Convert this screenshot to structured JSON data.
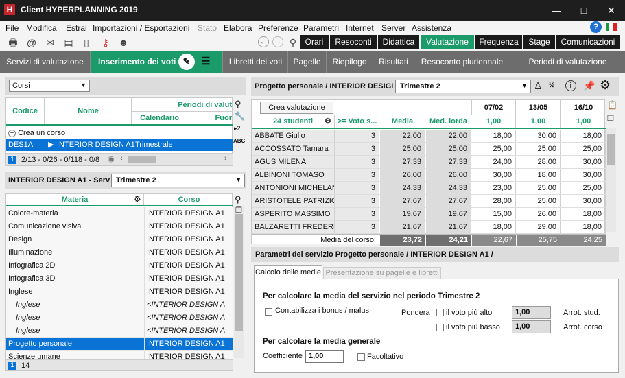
{
  "window": {
    "title": "Client HYPERPLANNING 2019",
    "logo": "H",
    "min": "—",
    "max": "□",
    "close": "✕"
  },
  "menu": [
    "File",
    "Modifica",
    "Estrai",
    "Importazioni / Esportazioni",
    "Stato",
    "Elabora",
    "Preferenze",
    "Parametri",
    "Internet",
    "Server",
    "Assistenza"
  ],
  "help": "?",
  "navtabs": [
    "Orari",
    "Resoconti",
    "Didattica",
    "Valutazione",
    "Frequenza",
    "Stage",
    "Comunicazioni"
  ],
  "subtabs": [
    "Servizi di valutazione",
    "Inserimento dei voti",
    "Libretti dei voti",
    "Pagelle",
    "Riepilogo",
    "Risultati",
    "Resoconto pluriennale",
    "Periodi di valutazione"
  ],
  "left_top": {
    "select": "Corsi",
    "col_code": "Codice",
    "col_name": "Nome",
    "col_periods": "Periodi di valut",
    "col_cal": "Calendario",
    "col_fuori": "Fuor",
    "create": "Crea un corso",
    "row": {
      "code": "DES1A",
      "name": "INTERIOR DESIGN A1",
      "cal": "Trimestrale"
    },
    "page": "1",
    "status": "2/13 - 0/26 - 0/118 - 0/8"
  },
  "left_bottom": {
    "label": "INTERIOR DESIGN A1 - Serv",
    "period": "Trimestre 2",
    "col_subject": "Materia",
    "col_course": "Corso",
    "rows": [
      {
        "s": "Colore-materia",
        "c": "INTERIOR DESIGN A1",
        "i": false
      },
      {
        "s": "Comunicazione visiva",
        "c": "INTERIOR DESIGN A1",
        "i": false
      },
      {
        "s": "Design",
        "c": "INTERIOR DESIGN A1",
        "i": false
      },
      {
        "s": "Illuminazione",
        "c": "INTERIOR DESIGN A1",
        "i": false
      },
      {
        "s": "Infografica 2D",
        "c": "INTERIOR DESIGN A1",
        "i": false
      },
      {
        "s": "Infografica 3D",
        "c": "INTERIOR DESIGN A1",
        "i": false
      },
      {
        "s": "Inglese",
        "c": "INTERIOR DESIGN A1",
        "i": false
      },
      {
        "s": "Inglese",
        "c": "<INTERIOR DESIGN A",
        "i": true
      },
      {
        "s": "Inglese",
        "c": "<INTERIOR DESIGN A",
        "i": true
      },
      {
        "s": "Inglese",
        "c": "<INTERIOR DESIGN A",
        "i": true
      },
      {
        "s": "Progetto personale",
        "c": "INTERIOR DESIGN A1",
        "i": false
      },
      {
        "s": "Scienze umane",
        "c": "INTERIOR DESIGN A1",
        "i": false
      }
    ],
    "selected_index": 10,
    "page": "1",
    "count": "14"
  },
  "right": {
    "title": "Progetto personale / INTERIOR DESIGI",
    "period": "Trimestre 2",
    "create_btn": "Crea valutazione",
    "students": "24 studenti",
    "col_voto": ">= Voto s...",
    "col_media": "Media",
    "col_lorda": "Med. lorda",
    "dates": [
      "07/02",
      "13/05",
      "16/10"
    ],
    "coeffs": [
      "1,00",
      "1,00",
      "1,00"
    ],
    "rows": [
      {
        "n": "ABBATE Giulio",
        "v": "3",
        "m": "22,00",
        "l": "22,00",
        "g": [
          "18,00",
          "30,00",
          "18,00"
        ]
      },
      {
        "n": "ACCOSSATO Tamara",
        "v": "3",
        "m": "25,00",
        "l": "25,00",
        "g": [
          "25,00",
          "25,00",
          "25,00"
        ]
      },
      {
        "n": "AGUS MILENA",
        "v": "3",
        "m": "27,33",
        "l": "27,33",
        "g": [
          "24,00",
          "28,00",
          "30,00"
        ]
      },
      {
        "n": "ALBINONI TOMASO",
        "v": "3",
        "m": "26,00",
        "l": "26,00",
        "g": [
          "30,00",
          "18,00",
          "30,00"
        ]
      },
      {
        "n": "ANTONIONI MICHELANG",
        "v": "3",
        "m": "24,33",
        "l": "24,33",
        "g": [
          "23,00",
          "25,00",
          "25,00"
        ]
      },
      {
        "n": "ARISTOTELE PATRIZIO",
        "v": "3",
        "m": "27,67",
        "l": "27,67",
        "g": [
          "28,00",
          "25,00",
          "30,00"
        ]
      },
      {
        "n": "ASPERITO MASSIMO",
        "v": "3",
        "m": "19,67",
        "l": "19,67",
        "g": [
          "15,00",
          "26,00",
          "18,00"
        ]
      },
      {
        "n": "BALZARETTI FREDERIC",
        "v": "3",
        "m": "21,67",
        "l": "21,67",
        "g": [
          "18,00",
          "29,00",
          "18,00"
        ]
      }
    ],
    "footer": {
      "label": "Media del corso:",
      "media": "23,72",
      "lorda": "24,21",
      "g": [
        "22,67",
        "25,75",
        "24,25"
      ]
    }
  },
  "params": {
    "header": "Parametri del servizio Progetto personale / INTERIOR DESIGN A1 /",
    "tab_active": "Calcolo delle medie",
    "tab_other": "Presentazione su pagelle e libretti",
    "section1": "Per calcolare la media del servizio nel periodo Trimestre 2",
    "bonus": "Contabilizza i bonus / malus",
    "pondera": "Pondera",
    "alto": "il voto più alto",
    "basso": "il voto più basso",
    "alto_val": "1,00",
    "basso_val": "1,00",
    "arrot_stud": "Arrot. stud.",
    "arrot_corso": "Arrot. corso",
    "section2": "Per calcolare la media generale",
    "coeff_label": "Coefficiente",
    "coeff_val": "1,00",
    "facoltativo": "Facoltativo"
  }
}
